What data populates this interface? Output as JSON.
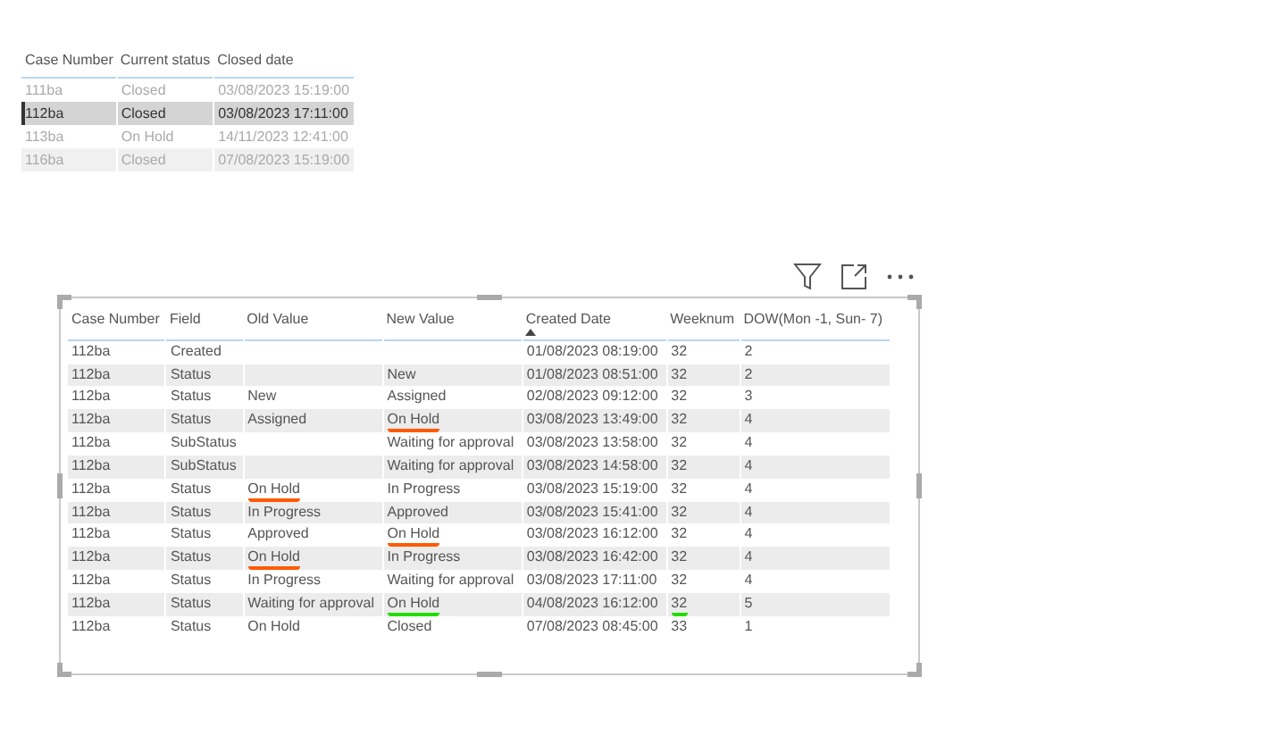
{
  "summary_table": {
    "columns": [
      "Case Number",
      "Current status",
      "Closed date"
    ],
    "rows": [
      {
        "cells": [
          "111ba",
          "Closed",
          "03/08/2023 15:19:00"
        ],
        "selected": false
      },
      {
        "cells": [
          "112ba",
          "Closed",
          "03/08/2023 17:11:00"
        ],
        "selected": true
      },
      {
        "cells": [
          "113ba",
          "On Hold",
          "14/11/2023 12:41:00"
        ],
        "selected": false
      },
      {
        "cells": [
          "116ba",
          "Closed",
          "07/08/2023 15:19:00"
        ],
        "selected": false
      }
    ]
  },
  "history_table": {
    "columns": [
      {
        "label": "Case Number",
        "sorted": false
      },
      {
        "label": "Field",
        "sorted": false
      },
      {
        "label": "Old Value",
        "sorted": false
      },
      {
        "label": "New Value",
        "sorted": false
      },
      {
        "label": "Created Date",
        "sorted": true
      },
      {
        "label": "Weeknum",
        "sorted": false
      },
      {
        "label": "DOW(Mon -1, Sun- 7)",
        "sorted": false
      }
    ],
    "rows": [
      {
        "cells": [
          {
            "text": "112ba"
          },
          {
            "text": "Created"
          },
          {
            "text": ""
          },
          {
            "text": ""
          },
          {
            "text": "01/08/2023 08:19:00"
          },
          {
            "text": "32"
          },
          {
            "text": "2"
          }
        ]
      },
      {
        "cells": [
          {
            "text": "112ba"
          },
          {
            "text": "Status"
          },
          {
            "text": ""
          },
          {
            "text": "New"
          },
          {
            "text": "01/08/2023 08:51:00"
          },
          {
            "text": "32"
          },
          {
            "text": "2"
          }
        ]
      },
      {
        "cells": [
          {
            "text": "112ba"
          },
          {
            "text": "Status"
          },
          {
            "text": "New"
          },
          {
            "text": "Assigned"
          },
          {
            "text": "02/08/2023 09:12:00"
          },
          {
            "text": "32"
          },
          {
            "text": "3"
          }
        ]
      },
      {
        "cells": [
          {
            "text": "112ba"
          },
          {
            "text": "Status"
          },
          {
            "text": "Assigned"
          },
          {
            "text": "On Hold",
            "color": "#ff5a00"
          },
          {
            "text": "03/08/2023 13:49:00"
          },
          {
            "text": "32"
          },
          {
            "text": "4"
          }
        ]
      },
      {
        "cells": [
          {
            "text": "112ba"
          },
          {
            "text": "SubStatus"
          },
          {
            "text": ""
          },
          {
            "text": "Waiting for approval"
          },
          {
            "text": "03/08/2023 13:58:00"
          },
          {
            "text": "32"
          },
          {
            "text": "4"
          }
        ]
      },
      {
        "cells": [
          {
            "text": "112ba"
          },
          {
            "text": "SubStatus"
          },
          {
            "text": ""
          },
          {
            "text": "Waiting for approval"
          },
          {
            "text": "03/08/2023 14:58:00"
          },
          {
            "text": "32"
          },
          {
            "text": "4"
          }
        ]
      },
      {
        "cells": [
          {
            "text": "112ba"
          },
          {
            "text": "Status"
          },
          {
            "text": "On Hold",
            "color": "#ff5a00"
          },
          {
            "text": "In Progress"
          },
          {
            "text": "03/08/2023 15:19:00"
          },
          {
            "text": "32"
          },
          {
            "text": "4"
          }
        ]
      },
      {
        "cells": [
          {
            "text": "112ba"
          },
          {
            "text": "Status"
          },
          {
            "text": "In Progress"
          },
          {
            "text": "Approved"
          },
          {
            "text": "03/08/2023 15:41:00"
          },
          {
            "text": "32"
          },
          {
            "text": "4"
          }
        ]
      },
      {
        "cells": [
          {
            "text": "112ba"
          },
          {
            "text": "Status"
          },
          {
            "text": "Approved"
          },
          {
            "text": "On Hold",
            "color": "#ff5a00"
          },
          {
            "text": "03/08/2023 16:12:00"
          },
          {
            "text": "32"
          },
          {
            "text": "4"
          }
        ]
      },
      {
        "cells": [
          {
            "text": "112ba"
          },
          {
            "text": "Status"
          },
          {
            "text": "On Hold",
            "color": "#ff5a00"
          },
          {
            "text": "In Progress"
          },
          {
            "text": "03/08/2023 16:42:00"
          },
          {
            "text": "32"
          },
          {
            "text": "4"
          }
        ]
      },
      {
        "cells": [
          {
            "text": "112ba"
          },
          {
            "text": "Status"
          },
          {
            "text": "In Progress"
          },
          {
            "text": "Waiting for approval"
          },
          {
            "text": "03/08/2023 17:11:00"
          },
          {
            "text": "32"
          },
          {
            "text": "4"
          }
        ]
      },
      {
        "cells": [
          {
            "text": "112ba"
          },
          {
            "text": "Status"
          },
          {
            "text": "Waiting for approval"
          },
          {
            "text": "On Hold",
            "color": "#22dd00"
          },
          {
            "text": "04/08/2023 16:12:00"
          },
          {
            "text": "32",
            "color": "#22dd00"
          },
          {
            "text": "5"
          }
        ]
      },
      {
        "cells": [
          {
            "text": "112ba"
          },
          {
            "text": "Status"
          },
          {
            "text": "On Hold"
          },
          {
            "text": "Closed"
          },
          {
            "text": "07/08/2023 08:45:00"
          },
          {
            "text": "33"
          },
          {
            "text": "1"
          }
        ]
      }
    ]
  }
}
